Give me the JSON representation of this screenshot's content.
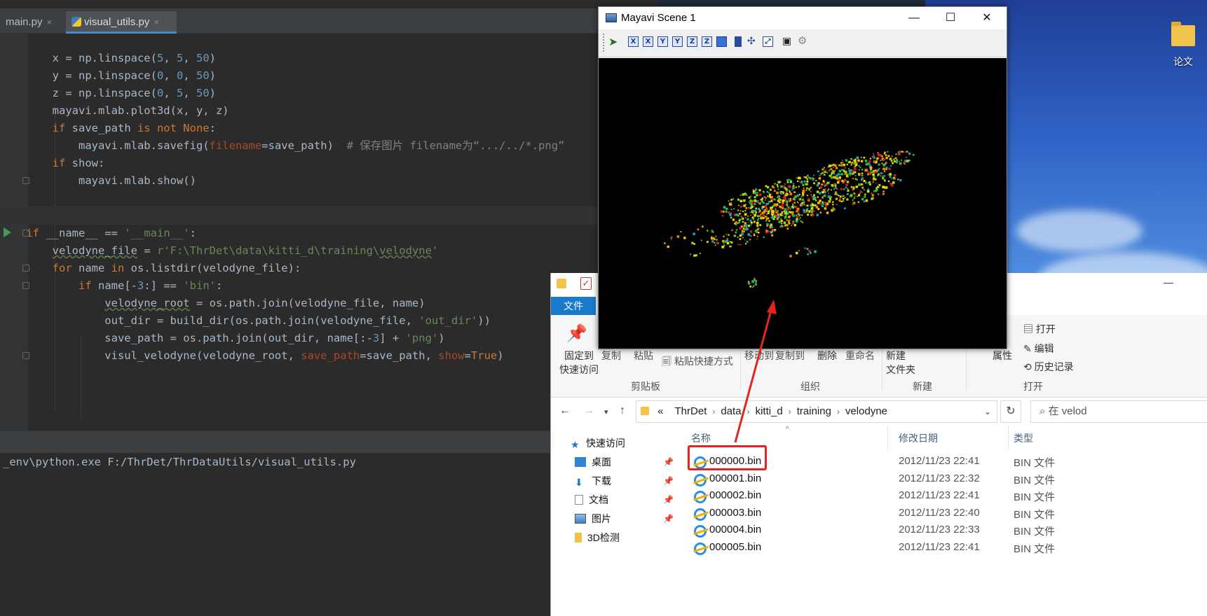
{
  "ide": {
    "tabs": [
      {
        "label": "main.py",
        "close": "×"
      },
      {
        "label": "visual_utils.py",
        "close": "×"
      }
    ],
    "console_line": "_env\\python.exe F:/ThrDet/ThrDataUtils/visual_utils.py"
  },
  "mayavi": {
    "title": "Mayavi Scene 1",
    "window_buttons": {
      "minimize": "—",
      "maximize": "☐",
      "close": "✕"
    },
    "toolbar_axes": [
      "X",
      "X",
      "Y",
      "Y",
      "Z",
      "Z"
    ]
  },
  "desktop": {
    "folder_label": "论文"
  },
  "explorer": {
    "file_tab": "文件",
    "minimize": "—",
    "ribbon": {
      "pin_label_1": "固定到",
      "pin_label_2": "快速访问",
      "copy": "复制",
      "paste": "粘贴",
      "paste_shortcut": "粘贴快捷方式",
      "move_to": "移动到",
      "copy_to": "复制到",
      "delete": "删除",
      "rename": "重命名",
      "new_folder_1": "新建",
      "new_folder_2": "文件夹",
      "properties": "属性",
      "open": "打开",
      "edit": "编辑",
      "history": "历史记录",
      "group_clipboard": "剪贴板",
      "group_organize": "组织",
      "group_new": "新建",
      "group_open": "打开"
    },
    "breadcrumb_prefix": "«",
    "breadcrumb": [
      "ThrDet",
      "data",
      "kitti_d",
      "training",
      "velodyne"
    ],
    "search_placeholder": "在 velod",
    "nav": [
      {
        "label": "快速访问",
        "pinned": false
      },
      {
        "label": "桌面",
        "pinned": true
      },
      {
        "label": "下载",
        "pinned": true
      },
      {
        "label": "文档",
        "pinned": true
      },
      {
        "label": "图片",
        "pinned": true
      },
      {
        "label": "3D检测",
        "pinned": false
      }
    ],
    "columns": {
      "name": "名称",
      "date": "修改日期",
      "type": "类型"
    },
    "files": [
      {
        "name": "000000.bin",
        "date": "2012/11/23 22:41",
        "type": "BIN 文件"
      },
      {
        "name": "000001.bin",
        "date": "2012/11/23 22:32",
        "type": "BIN 文件"
      },
      {
        "name": "000002.bin",
        "date": "2012/11/23 22:41",
        "type": "BIN 文件"
      },
      {
        "name": "000003.bin",
        "date": "2012/11/23 22:40",
        "type": "BIN 文件"
      },
      {
        "name": "000004.bin",
        "date": "2012/11/23 22:33",
        "type": "BIN 文件"
      },
      {
        "name": "000005.bin",
        "date": "2012/11/23 22:41",
        "type": "BIN 文件"
      }
    ]
  },
  "colors": {
    "ide_bg": "#2b2b2b",
    "keyword": "#cc7832",
    "number": "#6897bb",
    "string": "#6a8759",
    "highlight_red": "#e6231f",
    "explorer_accent": "#1979ca"
  }
}
